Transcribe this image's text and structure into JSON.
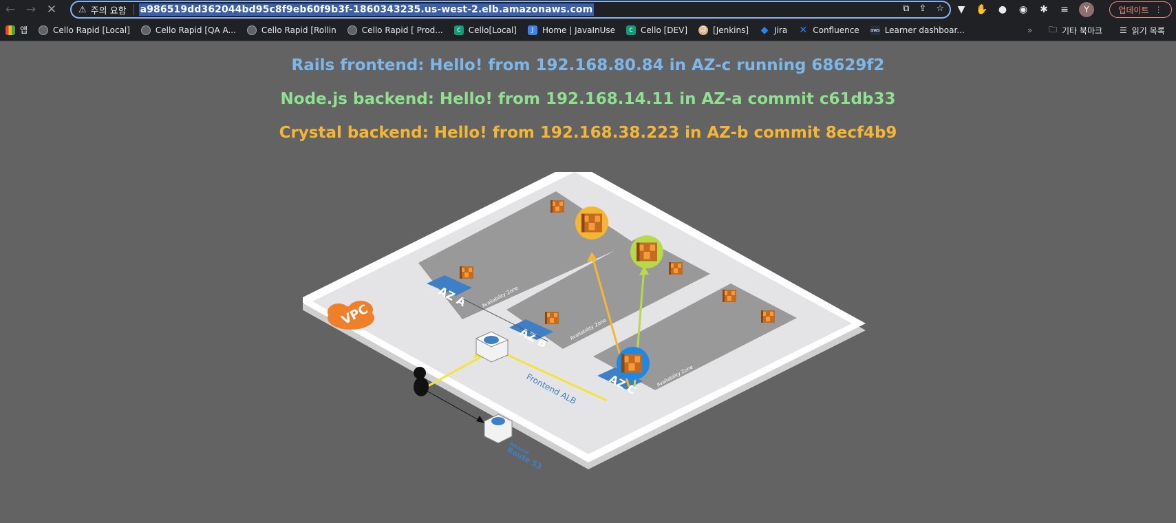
{
  "browser": {
    "security_warning": "주의 요함",
    "url": "a986519dd362044bd95c8f9eb60f9b3f-1860343235.us-west-2.elb.amazonaws.com",
    "update_label": "업데이트",
    "avatar_initial": "Y"
  },
  "bookmarks": {
    "apps_label": "앱",
    "items": [
      {
        "label": "Cello Rapid [Local]",
        "icon": "globe-icon"
      },
      {
        "label": "Cello Rapid [QA A...",
        "icon": "globe-icon"
      },
      {
        "label": "Cello Rapid [Rollin",
        "icon": "globe-icon"
      },
      {
        "label": "Cello Rapid [ Prod...",
        "icon": "globe-icon"
      },
      {
        "label": "Cello[Local]",
        "icon": "cello-icon"
      },
      {
        "label": "Home | JavaInUse",
        "icon": "javainuse-icon"
      },
      {
        "label": "Cello [DEV]",
        "icon": "cello-icon"
      },
      {
        "label": "[Jenkins]",
        "icon": "jenkins-icon"
      },
      {
        "label": "Jira",
        "icon": "jira-icon"
      },
      {
        "label": "Confluence",
        "icon": "confluence-icon"
      },
      {
        "label": "Learner dashboar...",
        "icon": "aws-icon"
      }
    ],
    "other_bookmarks": "기타 북마크",
    "reading_list": "읽기 목록"
  },
  "messages": {
    "rails": "Rails frontend: Hello! from 192.168.80.84 in AZ-c running 68629f2",
    "node": "Node.js backend: Hello! from 192.168.14.11 in AZ-a commit c61db33",
    "crystal": "Crystal backend: Hello! from 192.168.38.223 in AZ-b commit 8ecf4b9"
  },
  "diagram": {
    "vpc_label": "VPC",
    "az_a": "AZ A",
    "az_b": "AZ B",
    "az_c": "AZ C",
    "zone_label": "Availability Zone",
    "alb_label": "Frontend ALB",
    "route53_top": "Amazon",
    "route53_bottom": "Route 53",
    "colors": {
      "rails": "#7db7ea",
      "node": "#8fe08f",
      "crystal": "#f5b733",
      "vpc": "#f07f2a",
      "az_badge": "#3f7fc6"
    }
  }
}
